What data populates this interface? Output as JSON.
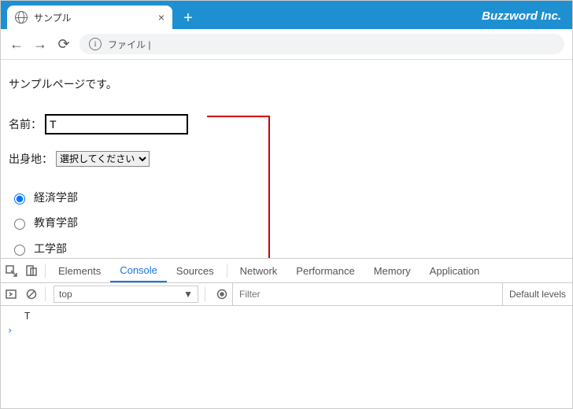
{
  "titlebar": {
    "tab_title": "サンプル",
    "brand": "Buzzword Inc."
  },
  "urlbar": {
    "text": "ファイル |"
  },
  "page": {
    "intro": "サンプルページです。",
    "name_label": "名前：",
    "name_value": "T",
    "origin_label": "出身地：",
    "origin_placeholder": "選択してください",
    "radios": [
      {
        "label": "経済学部",
        "checked": true
      },
      {
        "label": "教育学部",
        "checked": false
      },
      {
        "label": "工学部",
        "checked": false
      }
    ]
  },
  "devtools": {
    "tabs": [
      "Elements",
      "Console",
      "Sources",
      "Network",
      "Performance",
      "Memory",
      "Application"
    ],
    "active_tab": "Console",
    "context": "top",
    "filter_placeholder": "Filter",
    "levels": "Default levels",
    "log": "T"
  }
}
